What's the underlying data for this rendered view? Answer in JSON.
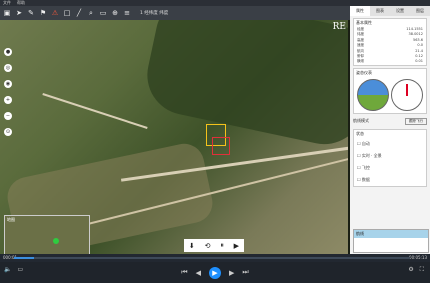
{
  "menubar": {
    "items": [
      "文件",
      "帮助"
    ]
  },
  "toolbar": {
    "icons": [
      "folder-icon",
      "cursor-icon",
      "pen-icon",
      "flag-icon",
      "warning-icon",
      "square-icon",
      "line-icon",
      "zoom-icon",
      "ruler-icon",
      "target-icon",
      "layers-icon"
    ],
    "info_text": "1  经纬度  纬度"
  },
  "map": {
    "overlay_right_text": "RE",
    "minimap_label": "地图"
  },
  "left_tools": [
    "●",
    "◎",
    "◉",
    "+",
    "−",
    "⊙"
  ],
  "control_bar": {
    "icons": [
      "⬇",
      "⟲",
      "⏸",
      "▶"
    ]
  },
  "panel": {
    "tabs": [
      "属性",
      "图表",
      "设置",
      "图层"
    ],
    "section1": {
      "title": "基本属性",
      "rows": [
        {
          "k": "经度",
          "v": "114.1551"
        },
        {
          "k": "纬度",
          "v": "38.0012"
        },
        {
          "k": "高度",
          "v": "563.6"
        },
        {
          "k": "速度",
          "v": "0.0"
        },
        {
          "k": "航向",
          "v": "21.4"
        },
        {
          "k": "俯仰",
          "v": "0.12"
        },
        {
          "k": "横滚",
          "v": "0.01"
        }
      ]
    },
    "section2": {
      "title": "姿态仪表"
    },
    "mode_row": {
      "label": "航线模式",
      "select_value": "跟踪飞行"
    },
    "checks": {
      "title": "状态",
      "items": [
        "自动",
        "实时 · 全景",
        "飞控",
        "数据"
      ]
    },
    "waypoints": {
      "title": "航线"
    }
  },
  "status": {
    "left": "000:01",
    "right": "00:05:13"
  },
  "progress": 0.05,
  "player": {
    "buttons": [
      "⏮",
      "◀",
      "⏵",
      "▶",
      "⏭"
    ]
  },
  "accent": "#1e90ff"
}
